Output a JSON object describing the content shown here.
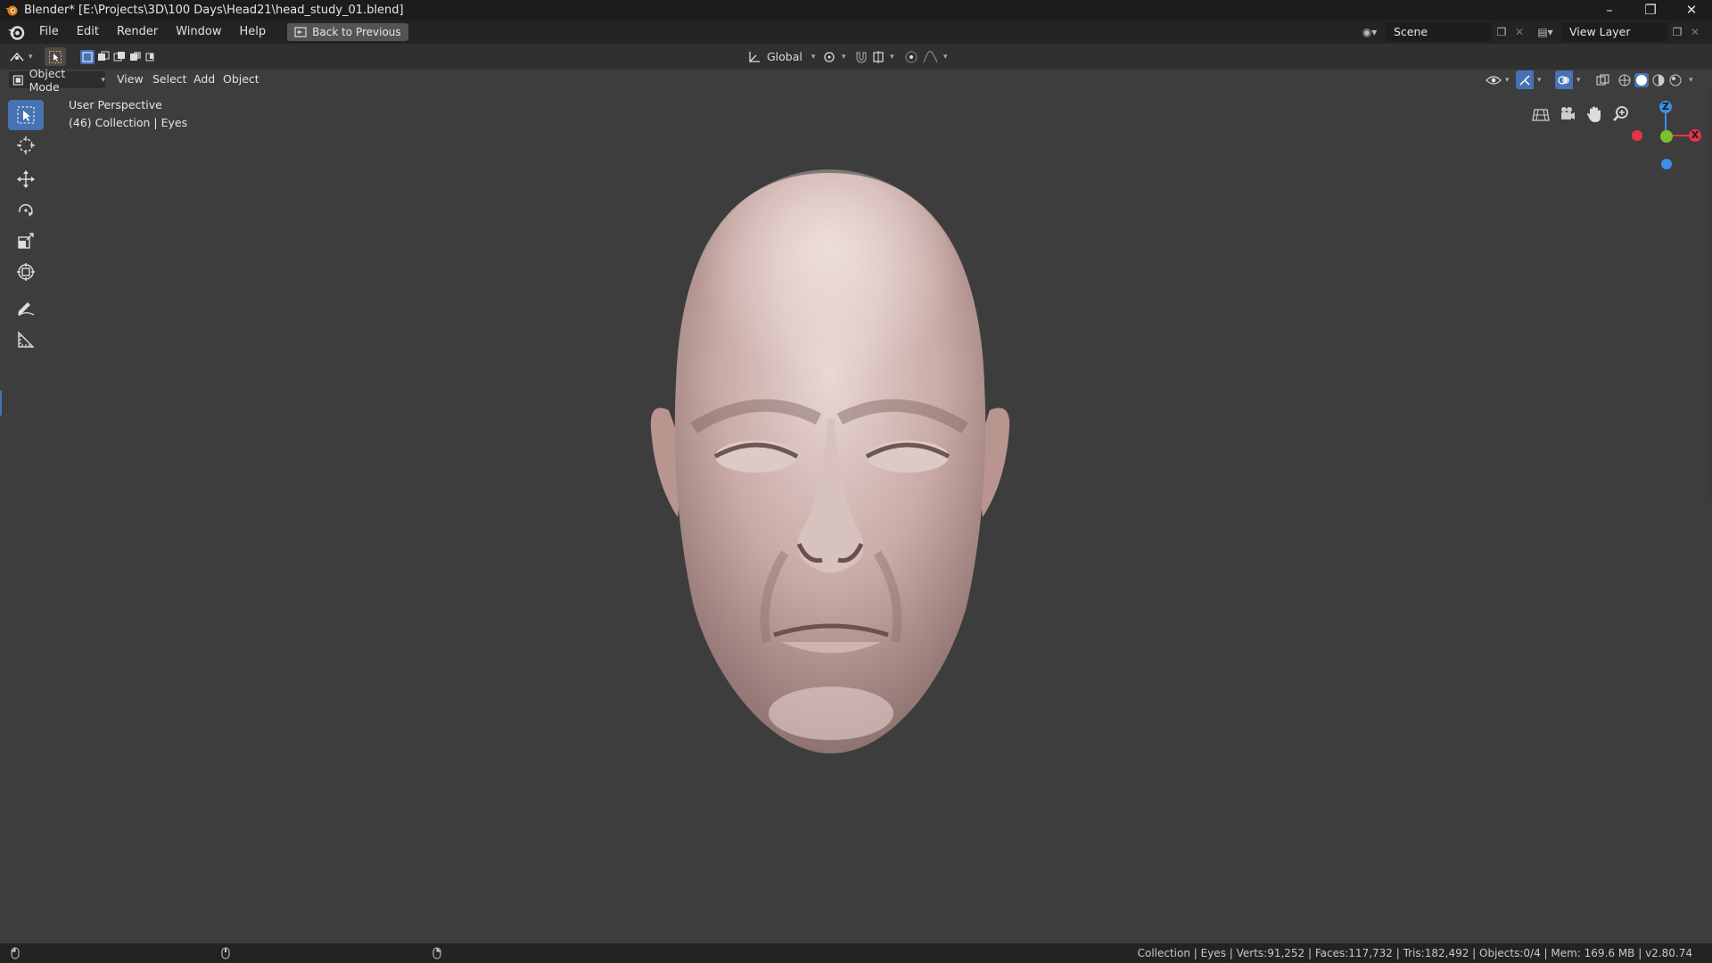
{
  "window": {
    "title": "Blender* [E:\\Projects\\3D\\100 Days\\Head21\\head_study_01.blend]",
    "controls": [
      "minimize",
      "restore",
      "close"
    ]
  },
  "menubar": {
    "items": [
      "File",
      "Edit",
      "Render",
      "Window",
      "Help"
    ],
    "back_button": "Back to Previous",
    "scene_name": "Scene",
    "view_layer_name": "View Layer"
  },
  "tool_header": {
    "transform_orientation": "Global"
  },
  "viewport_header": {
    "mode": "Object Mode",
    "menus": [
      "View",
      "Select",
      "Add",
      "Object"
    ]
  },
  "viewport": {
    "perspective_label": "User Perspective",
    "collection_label": "(46) Collection | Eyes",
    "gizmo_axes": {
      "x": "X",
      "y": "Y",
      "z": "Z"
    },
    "colors": {
      "x_axis": "#e8334a",
      "y_axis": "#7bc12a",
      "z_axis": "#3d8ee6",
      "accent": "#4772b3"
    }
  },
  "toolbar": {
    "tools": [
      "select-box",
      "cursor",
      "move",
      "rotate",
      "scale",
      "transform",
      "annotate",
      "measure"
    ],
    "active_tool": "select-box"
  },
  "statusbar": {
    "stats": "Collection | Eyes | Verts:91,252 | Faces:117,732 | Tris:182,492 | Objects:0/4 | Mem: 169.6 MB | v2.80.74"
  }
}
